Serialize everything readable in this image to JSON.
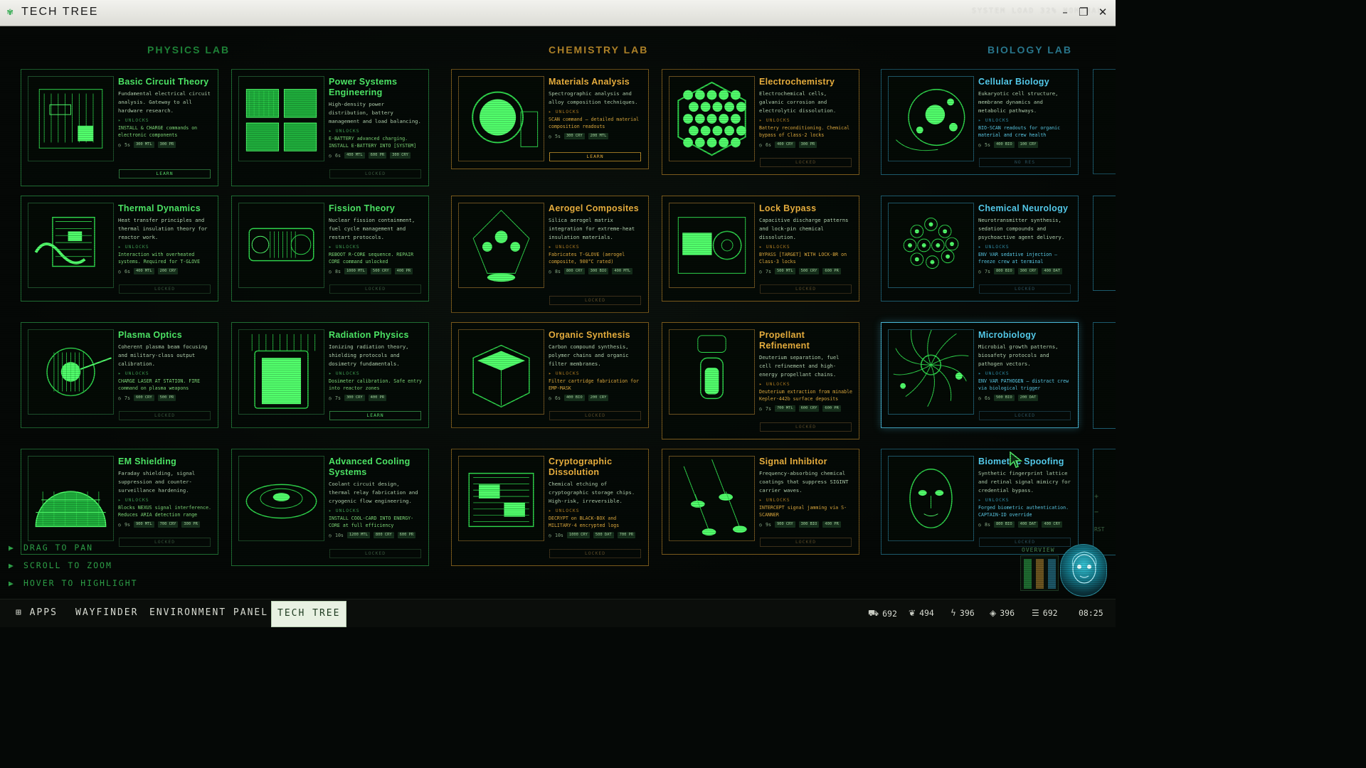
{
  "window": {
    "title": "TECH TREE",
    "system_load": "SYSTEM LOAD  32%  NOMINAL",
    "buttons": {
      "minimize": "–",
      "maximize": "❐",
      "close": "✕"
    }
  },
  "columns": {
    "physics": "PHYSICS LAB",
    "chemistry": "CHEMISTRY LAB",
    "biology": "BIOLOGY LAB"
  },
  "unlocks_label": "▸ UNLOCKS",
  "cards": [
    {
      "name": "Basic Circuit Theory",
      "desc": "Fundamental electrical circuit analysis. Gateway to all hardware research.",
      "effect": "INSTALL & CHARGE commands on electronic components",
      "time": "5s",
      "costs": [
        "300 MTL",
        "300 PR"
      ],
      "status": "LEARN"
    },
    {
      "name": "Power Systems Engineering",
      "desc": "High-density power distribution, battery management and load balancing.",
      "effect": "E-BATTERY advanced charging. INSTALL E-BATTERY INTO [SYSTEM]",
      "time": "6s",
      "costs": [
        "400 MTL",
        "600 PR",
        "300 CRY"
      ],
      "status": "LOCKED"
    },
    {
      "name": "Materials Analysis",
      "desc": "Spectrographic analysis and alloy composition techniques.",
      "effect": "SCAN command – detailed material composition readouts",
      "time": "5s",
      "costs": [
        "300 CRY",
        "200 MTL"
      ],
      "status": "LEARN"
    },
    {
      "name": "Electrochemistry",
      "desc": "Electrochemical cells, galvanic corrosion and electrolytic dissolution.",
      "effect": "Battery reconditioning. Chemical bypass of Class-2 locks",
      "time": "6s",
      "costs": [
        "400 CRY",
        "300 PR"
      ],
      "status": "LOCKED"
    },
    {
      "name": "Cellular Biology",
      "desc": "Eukaryotic cell structure, membrane dynamics and metabolic pathways.",
      "effect": "BIO-SCAN readouts for organic material and crew health",
      "time": "5s",
      "costs": [
        "400 BIO",
        "100 CRY"
      ],
      "status": "NO RES"
    },
    {
      "name": "Thermal Dynamics",
      "desc": "Heat transfer principles and thermal insulation theory for reactor work.",
      "effect": "Interaction with overheated systems. Required for T-GLOVE",
      "time": "6s",
      "costs": [
        "400 MTL",
        "200 CRY"
      ],
      "status": "LOCKED"
    },
    {
      "name": "Fission Theory",
      "desc": "Nuclear fission containment, fuel cycle management and restart protocols.",
      "effect": "REBOOT R-CORE sequence. REPAIR CORE command unlocked",
      "time": "8s",
      "costs": [
        "1000 MTL",
        "500 CRY",
        "400 PR"
      ],
      "status": "LOCKED"
    },
    {
      "name": "Aerogel Composites",
      "desc": "Silica aerogel matrix integration for extreme-heat insulation materials.",
      "effect": "Fabricates T-GLOVE (aerogel composite, 900°C rated)",
      "time": "8s",
      "costs": [
        "800 CRY",
        "300 BIO",
        "400 MTL"
      ],
      "status": "LOCKED"
    },
    {
      "name": "Lock Bypass",
      "desc": "Capacitive discharge patterns and lock-pin chemical dissolution.",
      "effect": "BYPASS [TARGET] WITH LOCK-BR on Class-3 locks",
      "time": "7s",
      "costs": [
        "500 MTL",
        "500 CRY",
        "600 PR"
      ],
      "status": "LOCKED"
    },
    {
      "name": "Chemical Neurology",
      "desc": "Neurotransmitter synthesis, sedation compounds and psychoactive agent delivery.",
      "effect": "ENV VAR sedative injection – freeze crew at terminal",
      "time": "7s",
      "costs": [
        "800 BIO",
        "300 CRY",
        "400 DAT"
      ],
      "status": "LOCKED"
    },
    {
      "name": "Plasma Optics",
      "desc": "Coherent plasma beam focusing and military-class output calibration.",
      "effect": "CHARGE LASER AT STATION. FIRE command on plasma weapons",
      "time": "7s",
      "costs": [
        "600 CRY",
        "500 PR"
      ],
      "status": "LOCKED"
    },
    {
      "name": "Radiation Physics",
      "desc": "Ionizing radiation theory, shielding protocols and dosimetry fundamentals.",
      "effect": "Dosimeter calibration. Safe entry into reactor zones",
      "time": "7s",
      "costs": [
        "300 CRY",
        "400 PR"
      ],
      "status": "LEARN"
    },
    {
      "name": "Organic Synthesis",
      "desc": "Carbon compound synthesis, polymer chains and organic filter membranes.",
      "effect": "Filter cartridge fabrication for EMP-MASK",
      "time": "6s",
      "costs": [
        "400 BIO",
        "200 CRY"
      ],
      "status": "LOCKED"
    },
    {
      "name": "Propellant Refinement",
      "desc": "Deuterium separation, fuel cell refinement and high-energy propellant chains.",
      "effect": "Deuterium extraction from minable Kepler-442b surface deposits",
      "time": "7s",
      "costs": [
        "700 MTL",
        "600 CRY",
        "600 PR"
      ],
      "status": "LOCKED"
    },
    {
      "name": "Microbiology",
      "desc": "Microbial growth patterns, biosafety protocols and pathogen vectors.",
      "effect": "ENV VAR PATHOGEN – distract crew via biological trigger",
      "time": "6s",
      "costs": [
        "500 BIO",
        "200 DAT"
      ],
      "status": "LOCKED"
    },
    {
      "name": "EM Shielding",
      "desc": "Faraday shielding, signal suppression and counter-surveillance hardening.",
      "effect": "Blocks NEXUS signal interference. Reduces ARIA detection range",
      "time": "9s",
      "costs": [
        "900 MTL",
        "700 CRY",
        "300 PR"
      ],
      "status": "LOCKED"
    },
    {
      "name": "Advanced Cooling Systems",
      "desc": "Coolant circuit design, thermal relay fabrication and cryogenic flow engineering.",
      "effect": "INSTALL COOL-CARD INTO ENERGY-CORE at full efficiency",
      "time": "10s",
      "costs": [
        "1200 MTL",
        "800 CRY",
        "600 PR"
      ],
      "status": "LOCKED"
    },
    {
      "name": "Cryptographic Dissolution",
      "desc": "Chemical etching of cryptographic storage chips. High-risk, irreversible.",
      "effect": "DECRYPT on BLACK-BOX and MILITARY-4 encrypted logs",
      "time": "10s",
      "costs": [
        "1000 CRY",
        "500 DAT",
        "700 PR"
      ],
      "status": "LOCKED"
    },
    {
      "name": "Signal Inhibitor",
      "desc": "Frequency-absorbing chemical coatings that suppress SIGINT carrier waves.",
      "effect": "INTERCEPT signal jamming via S-SCANNER",
      "time": "9s",
      "costs": [
        "900 CRY",
        "300 BIO",
        "400 PR"
      ],
      "status": "LOCKED"
    },
    {
      "name": "Biometric Spoofing",
      "desc": "Synthetic fingerprint lattice and retinal signal mimicry for credential bypass.",
      "effect": "Forged biometric authentication. CAPTAIN-ID override",
      "time": "8s",
      "costs": [
        "800 BIO",
        "400 DAT",
        "400 CRY"
      ],
      "status": "LOCKED"
    }
  ],
  "hints": [
    "DRAG TO PAN",
    "SCROLL TO ZOOM",
    "HOVER TO HIGHLIGHT"
  ],
  "overview": {
    "label": "OVERVIEW",
    "reset": "RST",
    "zoom_in": "+",
    "zoom_out": "−"
  },
  "taskbar": {
    "apps": "⊞ APPS",
    "wayfinder": "WAYFINDER",
    "environment_panel": "ENVIRONMENT PANEL",
    "tech_tree": "TECH TREE",
    "resources": [
      {
        "icon": "ore-icon",
        "value": "692"
      },
      {
        "icon": "plant-icon",
        "value": "494"
      },
      {
        "icon": "power-icon",
        "value": "396"
      },
      {
        "icon": "crystal-icon",
        "value": "396"
      },
      {
        "icon": "data-icon",
        "value": "692"
      }
    ],
    "clock": "08:25"
  },
  "colors": {
    "physics": "#50f06a",
    "chemistry": "#f2b640",
    "biology": "#58d4f6",
    "taskbar_active": "#e8f1e2"
  }
}
